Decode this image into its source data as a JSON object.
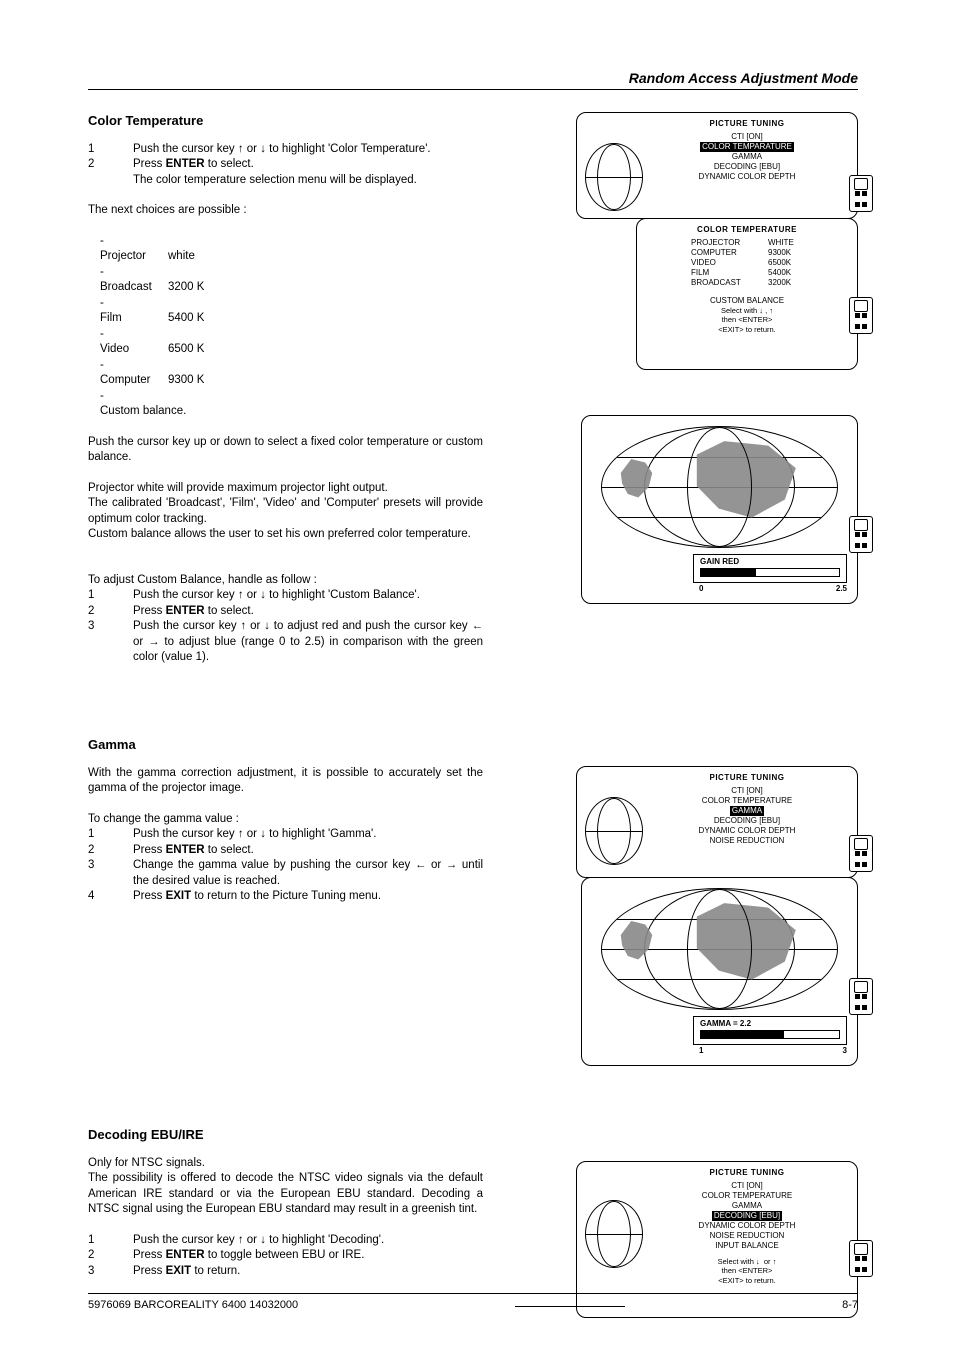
{
  "header": "Random Access Adjustment Mode",
  "sec1": {
    "title": "Color Temperature",
    "s1_pre": "Push the cursor key ",
    "s1_mid": " or ",
    "s1_post": " to highlight 'Color Temperature'.",
    "s2_a": "Press ",
    "s2_b": "ENTER",
    "s2_c": " to select.",
    "s2_d": "The color temperature selection menu will be displayed.",
    "next": "The next choices are possible :",
    "opts": [
      [
        "Projector",
        "white"
      ],
      [
        "Broadcast",
        "3200 K"
      ],
      [
        "Film",
        "5400 K"
      ],
      [
        "Video",
        "6500 K"
      ],
      [
        "Computer",
        "9300 K"
      ],
      [
        "Custom balance.",
        ""
      ]
    ],
    "p1": "Push the cursor key up or down to select a fixed color temperature or custom balance.",
    "p2a": "Projector white will provide maximum projector light output.",
    "p2b": "The calibrated 'Broadcast', 'Film', 'Video' and 'Computer' presets will provide optimum color tracking.",
    "p2c": "Custom balance allows the user to set his own preferred color temperature.",
    "adj": "To adjust Custom Balance, handle as follow :",
    "a1_pre": "Push the cursor key ",
    "a1_mid": " or ",
    "a1_post": " to highlight 'Custom Balance'.",
    "a2_a": "Press ",
    "a2_b": "ENTER",
    "a2_c": " to select.",
    "a3_pre": "Push the cursor key ",
    "a3_mid1": " or ",
    "a3_mid2": " to adjust red and push the cursor key ",
    "a3_mid3": " or ",
    "a3_post": " to adjust blue (range 0 to 2.5) in comparison with the green color (value 1)."
  },
  "osd1": {
    "title": "PICTURE TUNING",
    "l1": "CTI [ON]",
    "l2": "COLOR TEMPARATURE",
    "l3": "GAMMA",
    "l4": "DECODING [EBU]",
    "l5": "DYNAMIC COLOR DEPTH"
  },
  "osd2": {
    "title": "COLOR TEMPERATURE",
    "rows": [
      [
        "PROJECTOR",
        "WHITE"
      ],
      [
        "COMPUTER",
        "9300K"
      ],
      [
        "VIDEO",
        "6500K"
      ],
      [
        "FILM",
        "5400K"
      ],
      [
        "BROADCAST",
        "3200K"
      ]
    ],
    "cb": "CUSTOM BALANCE",
    "h1": "Select with ",
    "h2": "then <ENTER>",
    "h3": "<EXIT> to return."
  },
  "gain": {
    "label": "GAIN RED",
    "min": "0",
    "max": "2.5",
    "pct": 40
  },
  "sec2": {
    "title": "Gamma",
    "intro": "With the gamma correction adjustment, it is possible to accurately set the gamma of the projector image.",
    "chg": "To change the gamma value :",
    "g1_pre": "Push the cursor key ",
    "g1_mid": " or ",
    "g1_post": " to highlight 'Gamma'.",
    "g2_a": "Press ",
    "g2_b": "ENTER",
    "g2_c": " to select.",
    "g3_pre": "Change the gamma value by pushing the cursor key ",
    "g3_mid": " or ",
    "g3_post": " until the desired value is reached.",
    "g4_a": "Press ",
    "g4_b": "EXIT",
    "g4_c": " to return to the Picture Tuning menu."
  },
  "osd3": {
    "title": "PICTURE TUNING",
    "l1": "CTI [ON]",
    "l2": "COLOR TEMPERATURE",
    "l3": "GAMMA",
    "l4": "DECODING [EBU]",
    "l5": "DYNAMIC COLOR DEPTH",
    "l6": "NOISE REDUCTION"
  },
  "gamma": {
    "label": "GAMMA = 2.2",
    "min": "1",
    "max": "3",
    "pct": 60
  },
  "sec3": {
    "title": "Decoding EBU/IRE",
    "p1": "Only for NTSC signals.",
    "p2": "The possibility is offered to decode the NTSC video signals via the default American IRE standard or via the European EBU standard. Decoding a NTSC signal using the European EBU standard may result in a greenish tint.",
    "d1_pre": "Push the cursor key ",
    "d1_mid": " or ",
    "d1_post": " to highlight 'Decoding'.",
    "d2_a": "Press ",
    "d2_b": "ENTER",
    "d2_c": " to toggle between EBU or IRE.",
    "d3_a": "Press ",
    "d3_b": "EXIT",
    "d3_c": " to return."
  },
  "osd4": {
    "title": "PICTURE TUNING",
    "l1": "CTI [ON]",
    "l2": "COLOR TEMPERATURE",
    "l3": "GAMMA",
    "l4": "DECODING [EBU]",
    "l5": "DYNAMIC COLOR DEPTH",
    "l6": "NOISE REDUCTION",
    "l7": "INPUT BALANCE",
    "h1": "Select with ",
    "h2": "then <ENTER>",
    "h3": "<EXIT> to return."
  },
  "footer": {
    "left": "5976069 BARCOREALITY 6400 14032000",
    "right": "8-7"
  },
  "glyph": {
    "up": "↑",
    "down": "↓",
    "left": "←",
    "right": "→",
    "sep": " , "
  }
}
